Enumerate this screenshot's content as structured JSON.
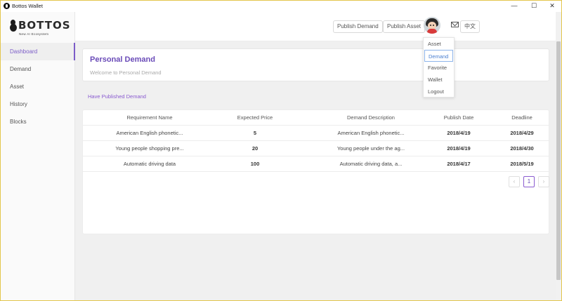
{
  "window": {
    "title": "Bottos Wallet",
    "controls": [
      "—",
      "☐",
      "✕"
    ]
  },
  "logo": {
    "word": "BOTTOS",
    "tagline": "New AI Ecosystem"
  },
  "sidebar": {
    "items": [
      {
        "label": "Dashboard",
        "active": true
      },
      {
        "label": "Demand",
        "active": false
      },
      {
        "label": "Asset",
        "active": false
      },
      {
        "label": "History",
        "active": false
      },
      {
        "label": "Blocks",
        "active": false
      }
    ]
  },
  "header": {
    "publish_demand": "Publish Demand",
    "publish_asset": "Publish Asset",
    "language": "中文"
  },
  "user_menu": {
    "items": [
      "Asset",
      "Demand",
      "Favorite",
      "Wallet",
      "Logout"
    ],
    "highlighted": "Demand"
  },
  "page": {
    "title": "Personal Demand",
    "subtitle": "Welcome to Personal Demand",
    "section_label": "Have Published Demand"
  },
  "table": {
    "columns": [
      "Requirement Name",
      "Expected Price",
      "Demand Description",
      "Publish Date",
      "Deadline"
    ],
    "rows": [
      [
        "American English phonetic...",
        "5",
        "American English phonetic...",
        "2018/4/19",
        "2018/4/29"
      ],
      [
        "Young people shopping pre...",
        "20",
        "Young people under the ag...",
        "2018/4/19",
        "2018/4/30"
      ],
      [
        "Automatic driving data",
        "100",
        "Automatic driving data, a...",
        "2018/4/17",
        "2018/5/19"
      ]
    ]
  },
  "pagination": {
    "prev": "‹",
    "current": "1",
    "next": "›"
  },
  "colors": {
    "accent": "#7b5cc8",
    "window_border": "#e3c64c",
    "content_bg": "#f0f0f0"
  }
}
